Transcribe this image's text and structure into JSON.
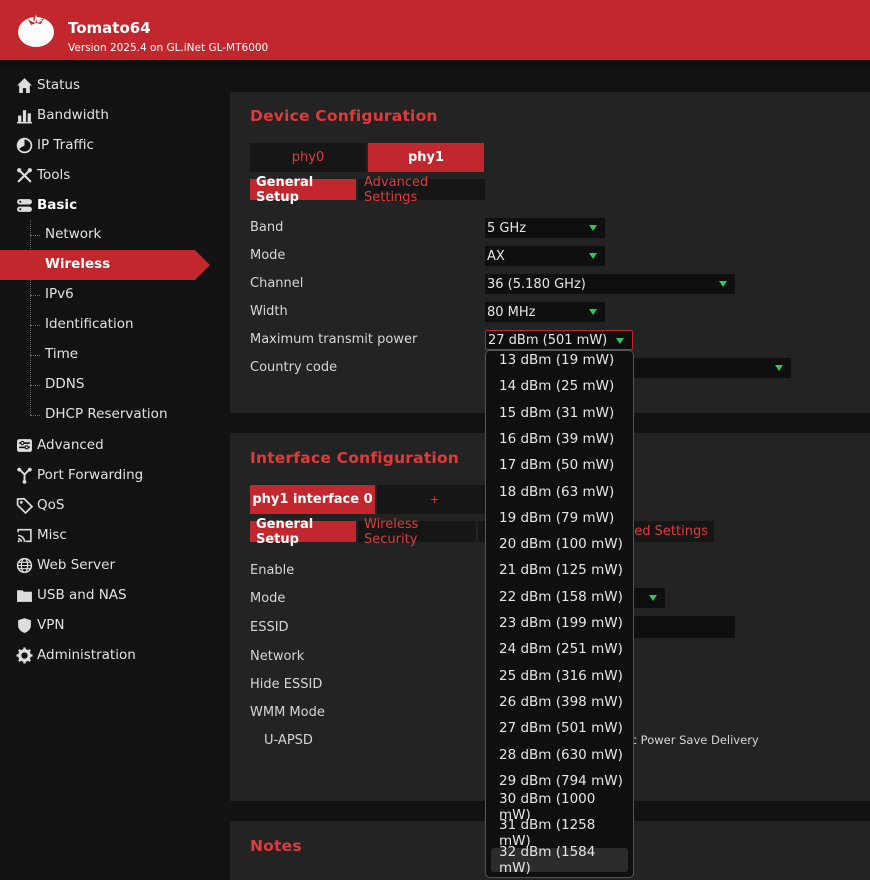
{
  "header": {
    "title": "Tomato64",
    "version": "Version 2025.4 on GL.iNet GL-MT6000"
  },
  "sidebar": {
    "items": [
      {
        "label": "Status",
        "icon": "home-icon"
      },
      {
        "label": "Bandwidth",
        "icon": "bar-chart-icon"
      },
      {
        "label": "IP Traffic",
        "icon": "pie-chart-icon"
      },
      {
        "label": "Tools",
        "icon": "tools-icon"
      },
      {
        "label": "Basic",
        "icon": "server-icon"
      }
    ],
    "basic_sub": [
      "Network",
      "Wireless",
      "IPv6",
      "Identification",
      "Time",
      "DDNS",
      "DHCP Reservation"
    ],
    "active_sub": "Wireless",
    "items_after": [
      {
        "label": "Advanced",
        "icon": "advanced-icon"
      },
      {
        "label": "Port Forwarding",
        "icon": "port-forwarding-icon"
      },
      {
        "label": "QoS",
        "icon": "tag-icon"
      },
      {
        "label": "Misc",
        "icon": "cast-icon"
      },
      {
        "label": "Web Server",
        "icon": "globe-icon"
      },
      {
        "label": "USB and NAS",
        "icon": "folder-icon"
      },
      {
        "label": "VPN",
        "icon": "shield-icon"
      },
      {
        "label": "Administration",
        "icon": "gear-icon"
      }
    ]
  },
  "device": {
    "title": "Device Configuration",
    "tabs": [
      "phy0",
      "phy1"
    ],
    "active_tab": "phy1",
    "subtabs": [
      "General Setup",
      "Advanced Settings"
    ],
    "fields": {
      "band": {
        "label": "Band",
        "value": "5 GHz"
      },
      "mode": {
        "label": "Mode",
        "value": "AX"
      },
      "channel": {
        "label": "Channel",
        "value": "36 (5.180 GHz)"
      },
      "width": {
        "label": "Width",
        "value": "80 MHz"
      },
      "txpower": {
        "label": "Maximum transmit power",
        "value": "27 dBm (501 mW)"
      },
      "country": {
        "label": "Country code",
        "value": ""
      }
    }
  },
  "iface": {
    "title": "Interface Configuration",
    "tabs": [
      "phy1 interface 0",
      "+"
    ],
    "subtabs": [
      "General Setup",
      "Wireless Security",
      "ced Settings"
    ],
    "labels": [
      "Enable",
      "Mode",
      "ESSID",
      "Network",
      "Hide ESSID",
      "WMM Mode",
      "U-APSD"
    ],
    "uapsd_text": "tic Power Save Delivery"
  },
  "notes": {
    "title": "Notes"
  },
  "txpower_options": [
    "13 dBm (19 mW)",
    "14 dBm (25 mW)",
    "15 dBm (31 mW)",
    "16 dBm (39 mW)",
    "17 dBm (50 mW)",
    "18 dBm (63 mW)",
    "19 dBm (79 mW)",
    "20 dBm (100 mW)",
    "21 dBm (125 mW)",
    "22 dBm (158 mW)",
    "23 dBm (199 mW)",
    "24 dBm (251 mW)",
    "25 dBm (316 mW)",
    "26 dBm (398 mW)",
    "27 dBm (501 mW)",
    "28 dBm (630 mW)",
    "29 dBm (794 mW)",
    "30 dBm (1000 mW)",
    "31 dBm (1258 mW)",
    "32 dBm (1584 mW)"
  ],
  "highlighted_option": "32 dBm (1584 mW)",
  "colors": {
    "accent": "#c1272d",
    "accent_text": "#e03b3b",
    "arrow": "#34c759",
    "panel": "#232323"
  }
}
